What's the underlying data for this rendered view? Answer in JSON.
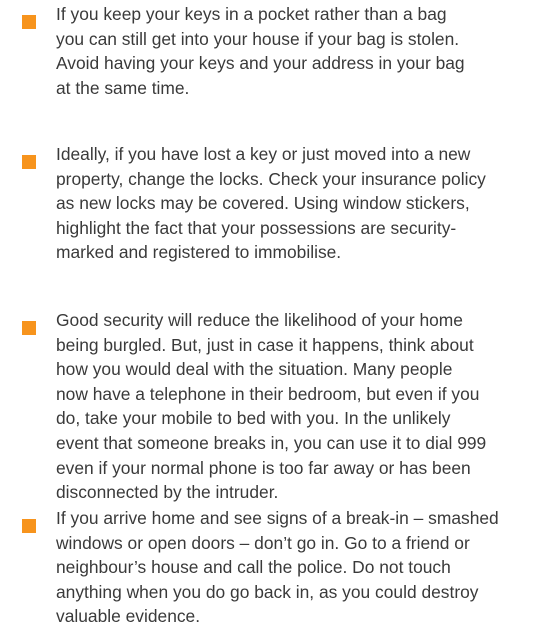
{
  "theme": {
    "bullet_color": "#f7941d",
    "text_color": "#3a3a3a",
    "background": "#ffffff"
  },
  "tips": [
    {
      "bullet_icon": "orange-square",
      "lines": [
        "If you keep your keys in a pocket rather than a bag",
        "you can still get into your house if your bag is stolen.",
        "Avoid having your keys and your address in your bag",
        "at the same time."
      ]
    },
    {
      "bullet_icon": "orange-square",
      "lines": [
        "Ideally, if you have lost a key or just moved into a new",
        "property, change the locks. Check your insurance policy",
        "as new locks may be covered. Using window stickers,",
        "highlight the fact that your possessions are security-",
        "marked and registered to immobilise."
      ]
    },
    {
      "bullet_icon": "orange-square",
      "lines": [
        "Good security will reduce the likelihood of your home",
        "being burgled. But, just in case it happens, think about",
        "how you would deal with the situation. Many people",
        "now have a telephone in their bedroom, but even if you",
        "do, take your mobile to bed with you. In the unlikely",
        "event that someone breaks in, you can use it to dial 999",
        "even if your normal phone is too far away or has been",
        "disconnected by the intruder."
      ]
    },
    {
      "bullet_icon": "orange-square",
      "lines": [
        "If you arrive home and see signs of a break-in – smashed",
        "windows or open doors – don’t go in. Go to a friend or",
        "neighbour’s house and call the police. Do not touch",
        "anything when you do go back in, as you could destroy",
        "valuable evidence."
      ]
    }
  ]
}
